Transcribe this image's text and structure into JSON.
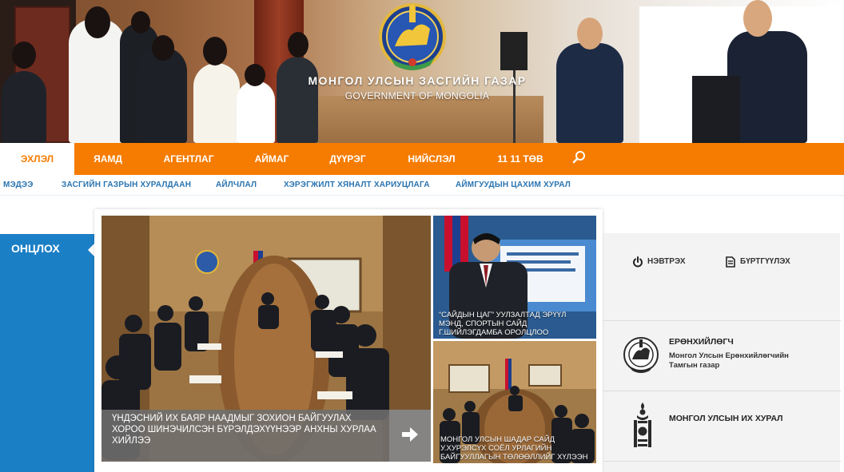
{
  "header": {
    "title": "МОНГОЛ УЛСЫН ЗАСГИЙН ГАЗАР",
    "subtitle": "GOVERNMENT OF MONGOLIA",
    "emblem_icon": "state-emblem-icon"
  },
  "main_nav": {
    "items": [
      {
        "label": "ЭХЛЭЛ",
        "active": true
      },
      {
        "label": "ЯАМД"
      },
      {
        "label": "АГЕНТЛАГ"
      },
      {
        "label": "АЙМАГ"
      },
      {
        "label": "ДҮҮРЭГ"
      },
      {
        "label": "НИЙСЛЭЛ"
      },
      {
        "label": "11 11 ТӨВ"
      }
    ],
    "search_icon": "search-icon",
    "background_color": "#f57c00"
  },
  "sub_nav": {
    "items": [
      {
        "label": "МЭДЭЭ"
      },
      {
        "label": "ЗАСГИЙН ГАЗРЫН ХУРАЛДААН"
      },
      {
        "label": "АЙЛЧЛАЛ"
      },
      {
        "label": "ХЭРЭГЖИЛТ ХЯНАЛТ ХАРИУЦЛАГА"
      },
      {
        "label": "АЙМГУУДЫН ЦАХИМ ХУРАЛ"
      }
    ],
    "text_color": "#2a74b0"
  },
  "featured": {
    "tab_label": "ОНЦЛОХ",
    "tab_color": "#1b7fc6",
    "main_story": {
      "caption": "ҮНДЭСНИЙ ИХ БАЯР НААДМЫГ ЗОХИОН БАЙГУУЛАХ ХОРОО ШИНЭЧИЛСЭН БҮРЭЛДЭХҮҮНЭЭР АНХНЫ ХУРЛАА ХИЙЛЭЭ",
      "arrow_icon": "arrow-right-icon"
    },
    "side_stories": [
      {
        "caption": "“САЙДЫН ЦАГ” УУЛЗАЛТАД ЭРҮҮЛ МЭНД, СПОРТЫН САЙД Г.ШИЙЛЭГДАМБА ОРОЛЦЛОО"
      },
      {
        "caption": "МОНГОЛ УЛСЫН ШАДАР САЙД У.ХУРЭЛСҮХ СОЁЛ УРЛАГИЙН БАЙГУУЛЛАГЫН ТӨЛӨӨЛЛИЙГ ХҮЛЭЭН"
      }
    ]
  },
  "right_panel": {
    "login_label": "НЭВТРЭХ",
    "login_icon": "power-icon",
    "register_label": "БҮРТГҮҮЛЭХ",
    "register_icon": "document-icon",
    "orgs": [
      {
        "title": "ЕРӨНХИЙЛӨГЧ",
        "subtitle": "Монгол Улсын Ерөнхийлөгчийн Тамгын газар",
        "icon": "presidential-seal-icon"
      },
      {
        "title": "МОНГОЛ УЛСЫН ИХ ХУРАЛ",
        "subtitle": "",
        "icon": "soyombo-icon"
      }
    ]
  }
}
